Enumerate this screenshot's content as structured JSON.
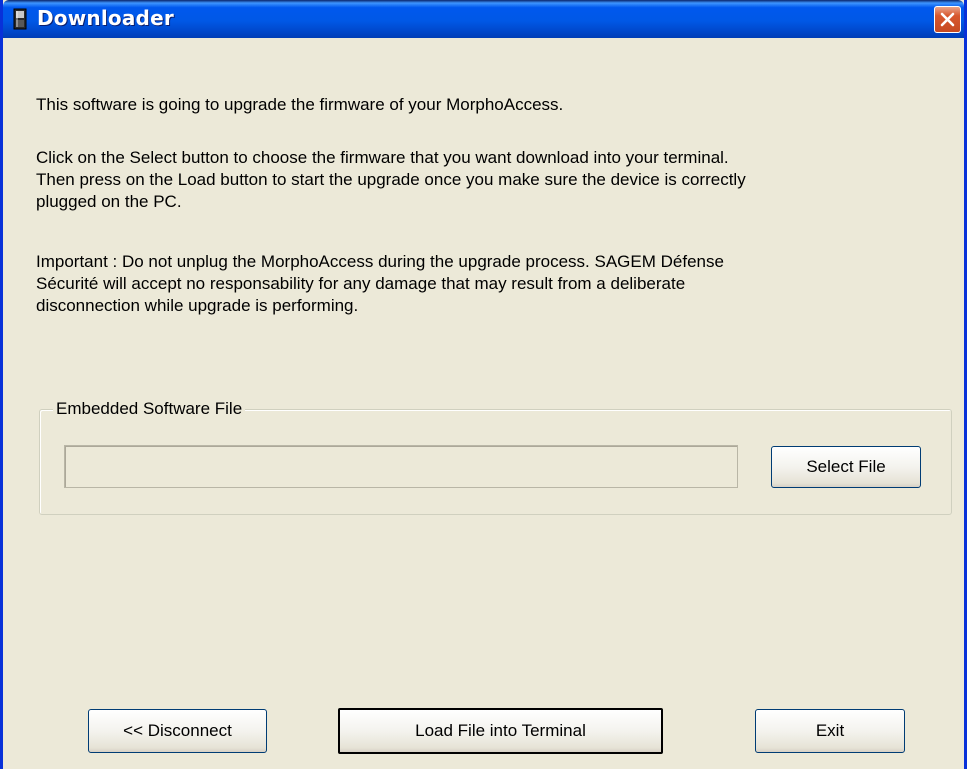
{
  "window": {
    "title": "Downloader",
    "icon": "device-icon",
    "close_icon": "close-icon"
  },
  "intro": "This software is going to upgrade the firmware of your MorphoAccess.",
  "instructions": [
    "Click on the Select button to choose the firmware that you want download into your terminal.",
    "Then press on the Load button to start the upgrade once you make sure the device is correctly",
    "plugged on the PC."
  ],
  "warning": [
    "Important : Do not unplug the MorphoAccess during the upgrade process. SAGEM Défense",
    "Sécurité will accept no responsability for any damage that may result from a deliberate",
    "disconnection while upgrade is performing."
  ],
  "file_group": {
    "label": "Embedded Software File",
    "path_value": "",
    "select_label": "Select File"
  },
  "footer": {
    "disconnect_label": "<< Disconnect",
    "load_label": "Load File into Terminal",
    "exit_label": "Exit"
  },
  "colors": {
    "window_bg": "#ECE9D8",
    "titlebar_blue": "#0058E6",
    "close_red": "#D8582E",
    "button_border": "#003C74"
  }
}
